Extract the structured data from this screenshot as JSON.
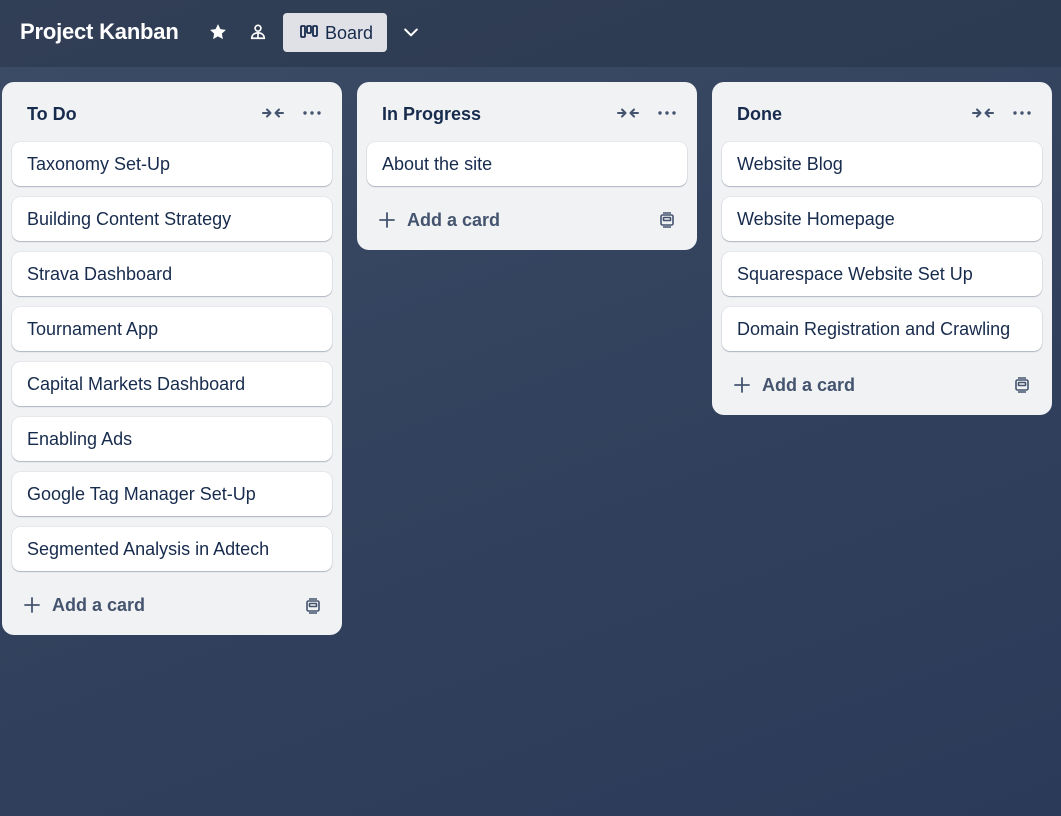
{
  "header": {
    "board_title": "Project Kanban",
    "view_label": "Board",
    "star_icon": "star-icon",
    "members_icon": "people-icon",
    "view_icon": "board-icon",
    "chevron_icon": "chevron-down-icon"
  },
  "lists": [
    {
      "title": "To Do",
      "cards": [
        "Taxonomy Set-Up",
        "Building Content Strategy",
        "Strava Dashboard",
        "Tournament App",
        "Capital Markets Dashboard",
        "Enabling Ads",
        "Google Tag Manager Set-Up",
        "Segmented Analysis in Adtech"
      ],
      "add_label": "Add a card"
    },
    {
      "title": "In Progress",
      "cards": [
        "About the site"
      ],
      "add_label": "Add a card"
    },
    {
      "title": "Done",
      "cards": [
        "Website Blog",
        "Website Homepage",
        "Squarespace Website Set Up",
        "Domain Registration and Crawling"
      ],
      "add_label": "Add a card"
    }
  ],
  "colors": {
    "background": "#34445f",
    "list_bg": "#f1f2f4",
    "card_bg": "#ffffff",
    "text": "#172b4d",
    "muted_text": "#44546f"
  }
}
